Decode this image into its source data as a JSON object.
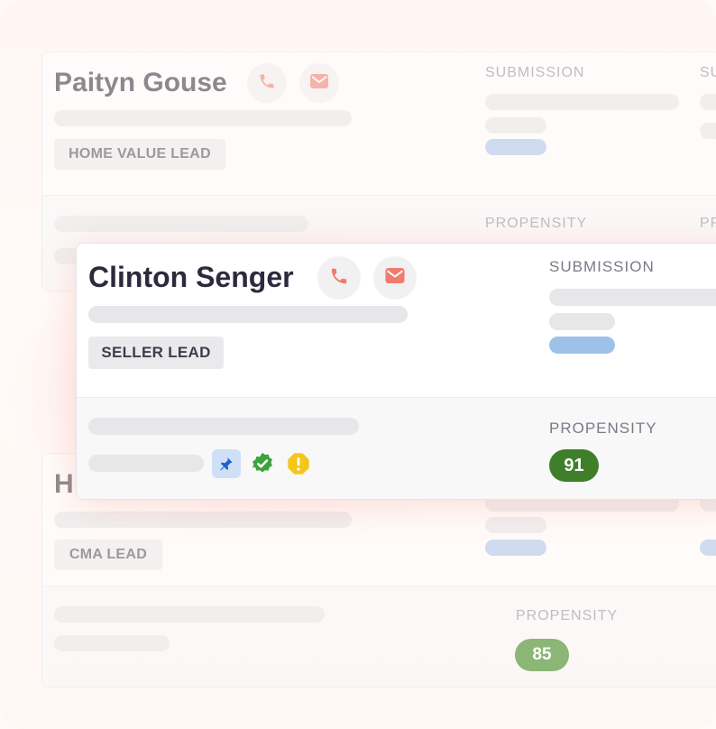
{
  "cards": [
    {
      "name": "Paityn Gouse",
      "tag": "HOME VALUE LEAD",
      "submission_label": "SUBMISSION",
      "submission_label_2": "SU",
      "propensity_label": "PROPENSITY",
      "propensity_label_2": "PR"
    },
    {
      "name": "Clinton Senger",
      "tag": "SELLER LEAD",
      "submission_label": "SUBMISSION",
      "propensity_label": "PROPENSITY",
      "propensity_score": "91"
    },
    {
      "name_partial": "H",
      "tag": "CMA LEAD",
      "propensity_label": "PROPENSITY",
      "propensity_score": "85"
    }
  ],
  "icons": {
    "phone": "phone-icon",
    "email": "email-icon",
    "pin": "pin-icon",
    "verified": "verified-badge-icon",
    "warning": "warning-icon"
  },
  "colors": {
    "phone_accent": "#f07c6d",
    "email_accent": "#f07c6d",
    "score_91": "#3f7f2a",
    "score_85": "#86b36f",
    "blue_bar": "#a8c6ec",
    "verified_green": "#3ea23c",
    "warning_yellow": "#f5c518"
  }
}
